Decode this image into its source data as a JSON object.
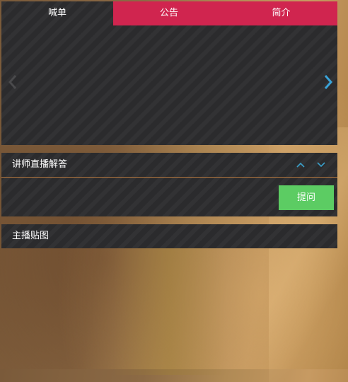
{
  "tabs": [
    {
      "label": "喊单",
      "active": true
    },
    {
      "label": "公告",
      "active": false
    },
    {
      "label": "简介",
      "active": false
    }
  ],
  "slider": {
    "prev_icon": "chevron-left-icon",
    "next_icon": "chevron-right-icon"
  },
  "qa": {
    "title": "讲师直播解答",
    "ask_label": "提问",
    "up_icon": "chevron-up-icon",
    "down_icon": "chevron-down-icon"
  },
  "stickers": {
    "title": "主播贴图"
  },
  "colors": {
    "tab_inactive_bg": "#d0254f",
    "panel_bg": "#2b2b2d",
    "ask_button_bg": "#5ccc63",
    "accent_arrow": "#3aa3d8",
    "divider": "#b5783f"
  }
}
